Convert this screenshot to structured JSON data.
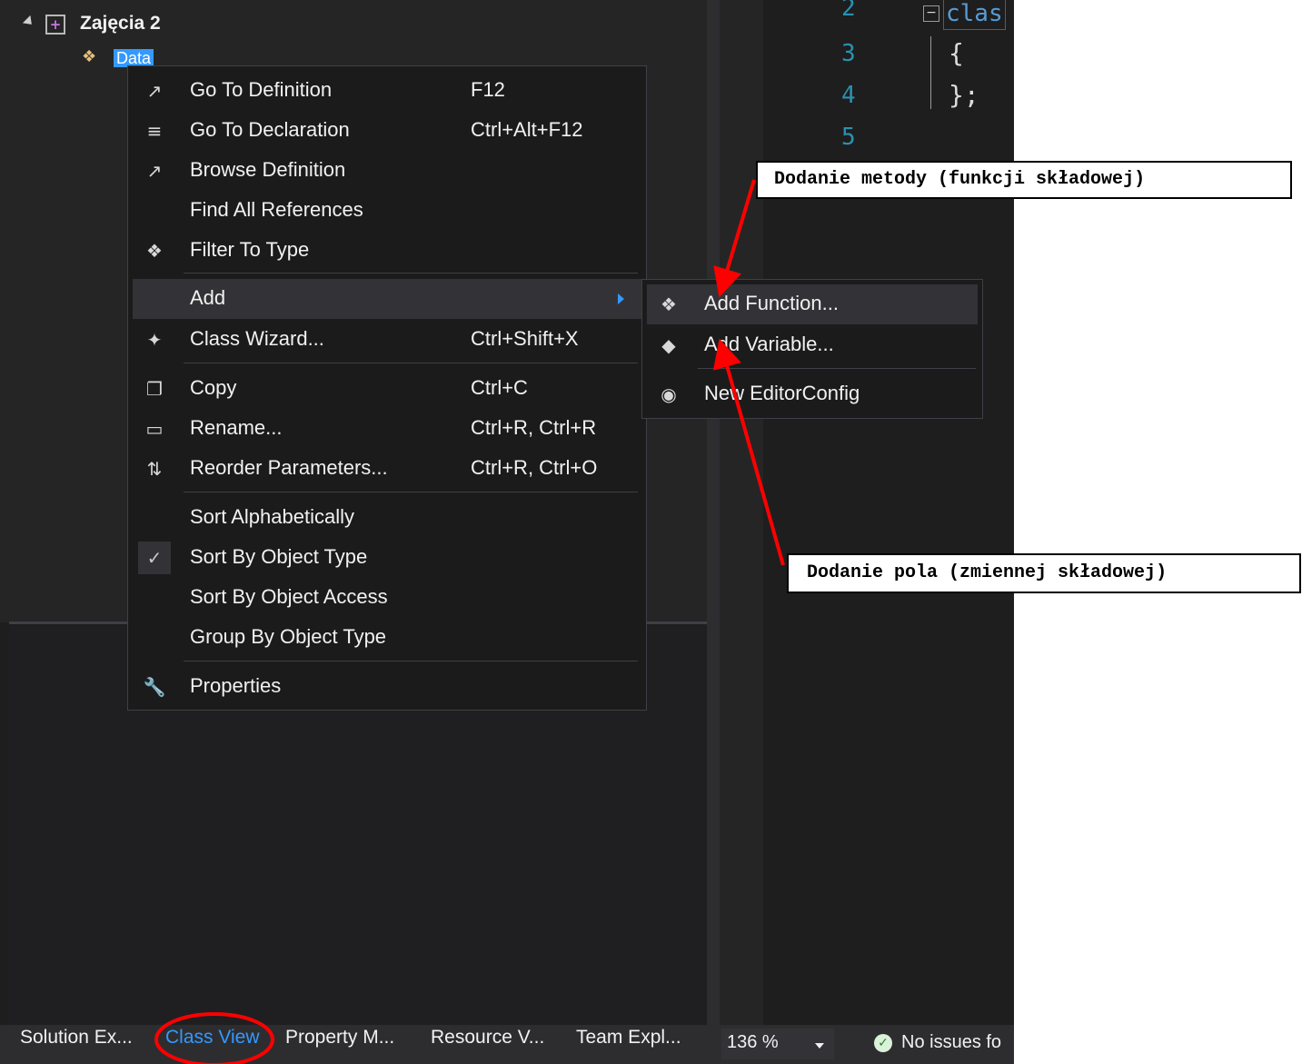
{
  "tree": {
    "project_label": "Zajęcia 2",
    "class_label": "Data"
  },
  "editor": {
    "line_numbers": [
      "2",
      "3",
      "4",
      "5"
    ],
    "code_lines": {
      "class_kw": "clas",
      "open_brace": "{",
      "close_brace": "};"
    }
  },
  "context_menu": {
    "items": [
      {
        "icon": "go-to-definition-icon",
        "label": "Go To Definition",
        "shortcut": "F12"
      },
      {
        "icon": "go-to-declaration-icon",
        "label": "Go To Declaration",
        "shortcut": "Ctrl+Alt+F12"
      },
      {
        "icon": "browse-definition-icon",
        "label": "Browse Definition",
        "shortcut": ""
      },
      {
        "icon": "",
        "label": "Find All References",
        "shortcut": ""
      },
      {
        "icon": "filter-type-icon",
        "label": "Filter To Type",
        "shortcut": ""
      },
      {
        "icon": "",
        "label": "Add",
        "shortcut": ""
      },
      {
        "icon": "class-wizard-icon",
        "label": "Class Wizard...",
        "shortcut": "Ctrl+Shift+X"
      },
      {
        "icon": "copy-icon",
        "label": "Copy",
        "shortcut": "Ctrl+C"
      },
      {
        "icon": "rename-icon",
        "label": "Rename...",
        "shortcut": "Ctrl+R, Ctrl+R"
      },
      {
        "icon": "reorder-parameters-icon",
        "label": "Reorder Parameters...",
        "shortcut": "Ctrl+R, Ctrl+O"
      },
      {
        "icon": "",
        "label": "Sort Alphabetically",
        "shortcut": ""
      },
      {
        "icon": "check-icon",
        "label": "Sort By Object Type",
        "shortcut": ""
      },
      {
        "icon": "",
        "label": "Sort By Object Access",
        "shortcut": ""
      },
      {
        "icon": "",
        "label": "Group By Object Type",
        "shortcut": ""
      },
      {
        "icon": "wrench-icon",
        "label": "Properties",
        "shortcut": ""
      }
    ]
  },
  "submenu": {
    "items": [
      {
        "icon": "add-function-icon",
        "label": "Add Function..."
      },
      {
        "icon": "add-variable-icon",
        "label": "Add Variable..."
      },
      {
        "icon": "editorconfig-icon",
        "label": "New EditorConfig"
      }
    ]
  },
  "bottom_tabs": [
    "Solution Ex...",
    "Class View",
    "Property M...",
    "Resource V...",
    "Team Expl..."
  ],
  "status": {
    "zoom": "136 %",
    "issues": "No issues fo"
  },
  "annotations": {
    "method_callout": "Dodanie metody (funkcji składowej)",
    "field_callout": "Dodanie pola (zmiennej składowej)",
    "arrow_color": "#ff0000"
  },
  "colors": {
    "selection": "#3399ff",
    "menu_bg": "#1b1b1c",
    "panel_bg": "#252526"
  }
}
